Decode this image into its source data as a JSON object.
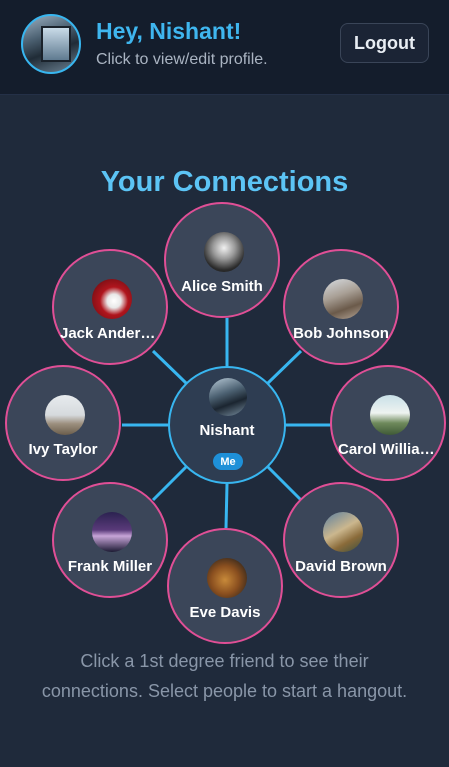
{
  "header": {
    "greeting": "Hey, Nishant!",
    "subtitle": "Click to view/edit profile.",
    "logout_label": "Logout"
  },
  "title": "Your Connections",
  "center": {
    "name": "Nishant",
    "badge": "Me"
  },
  "friends": [
    {
      "name": "Alice Smith"
    },
    {
      "name": "Bob Johnson"
    },
    {
      "name": "Carol Williams"
    },
    {
      "name": "David Brown"
    },
    {
      "name": "Eve Davis"
    },
    {
      "name": "Frank Miller"
    },
    {
      "name": "Ivy Taylor"
    },
    {
      "name": "Jack Anderson"
    }
  ],
  "hint": "Click a 1st degree friend to see their connections. Select people to start a hangout.",
  "colors": {
    "accent": "#3fb6ef",
    "ring": "#e04f96",
    "link": "#38b6f0"
  }
}
